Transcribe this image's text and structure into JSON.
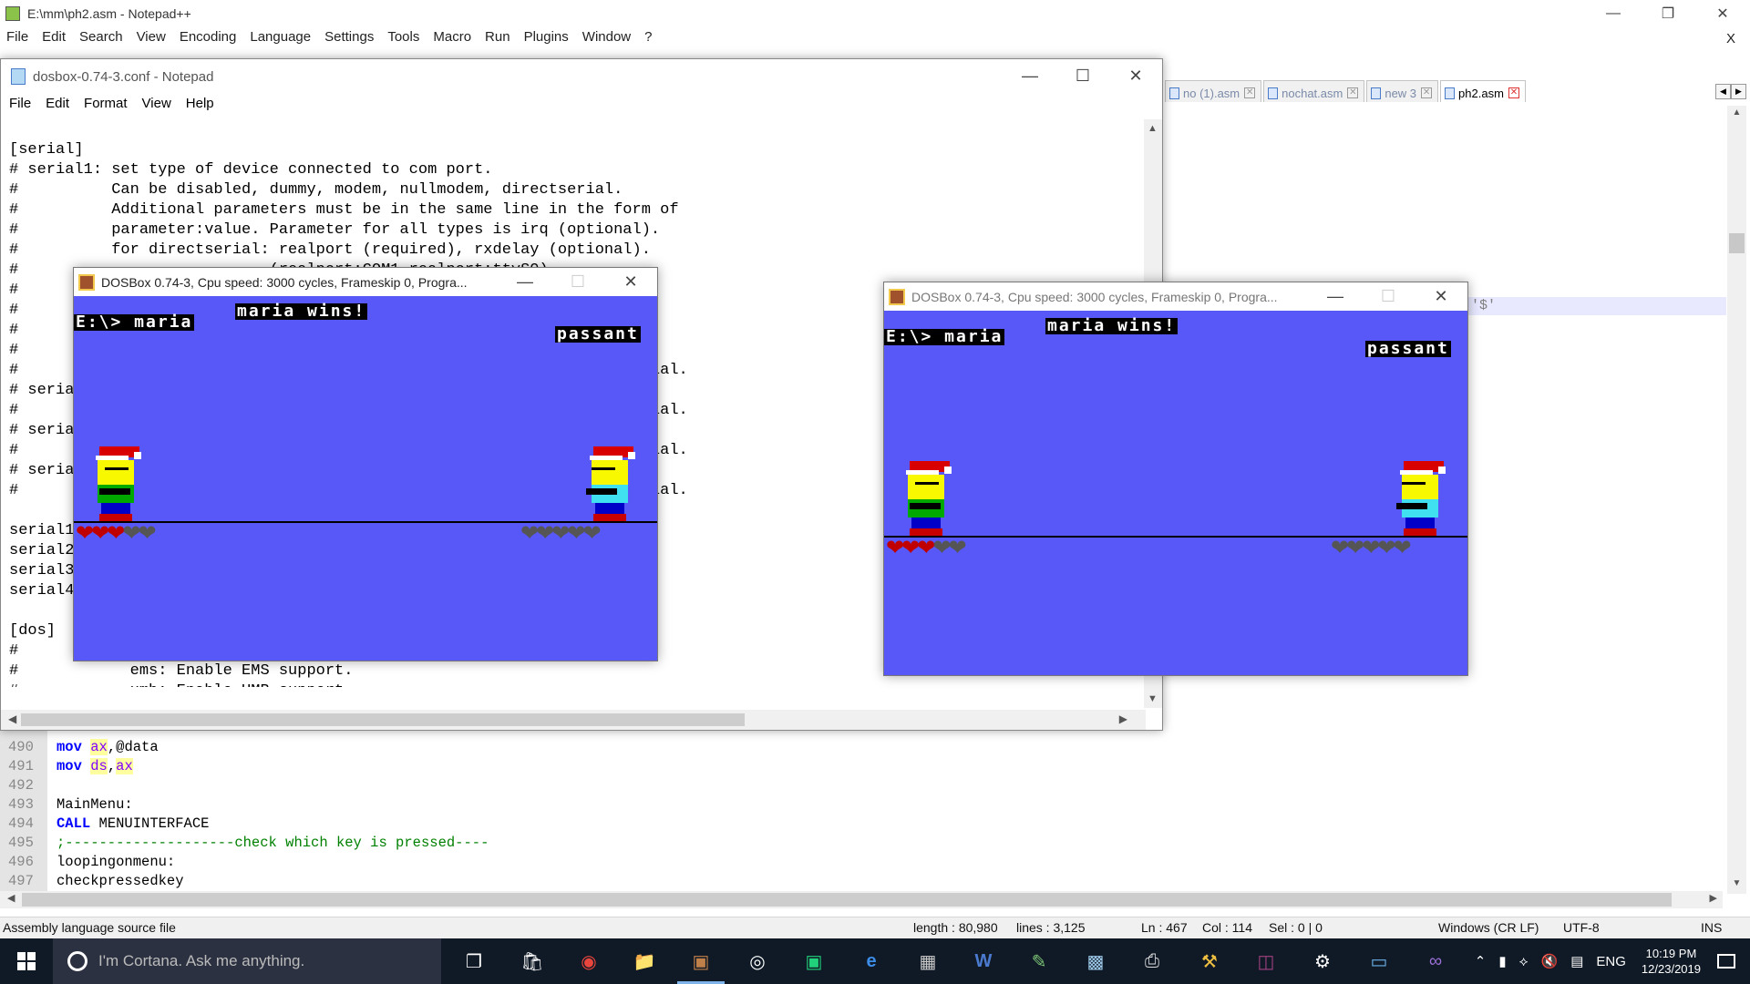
{
  "npp": {
    "title": "E:\\mm\\ph2.asm - Notepad++",
    "menu": [
      "File",
      "Edit",
      "Search",
      "View",
      "Encoding",
      "Language",
      "Settings",
      "Tools",
      "Macro",
      "Run",
      "Plugins",
      "Window",
      "?"
    ],
    "menu_close": "X",
    "tabs": [
      {
        "label": "no (1).asm",
        "active": false
      },
      {
        "label": "nochat.asm",
        "active": false
      },
      {
        "label": "new 3",
        "active": false
      },
      {
        "label": "ph2.asm",
        "active": true
      }
    ],
    "highlight_text": "'$'",
    "code_lines": [
      {
        "num": "490",
        "parts": [
          [
            "kw",
            "mov "
          ],
          [
            "reg",
            "ax"
          ],
          [
            "",
            ","
          ],
          [
            "",
            "@data"
          ]
        ]
      },
      {
        "num": "491",
        "parts": [
          [
            "kw",
            "mov "
          ],
          [
            "reg",
            "ds"
          ],
          [
            "",
            ","
          ],
          [
            "reg",
            "ax"
          ]
        ]
      },
      {
        "num": "492",
        "parts": []
      },
      {
        "num": "493",
        "parts": [
          [
            "",
            "MainMenu:"
          ]
        ]
      },
      {
        "num": "494",
        "parts": [
          [
            "kw",
            "CALL "
          ],
          [
            "",
            "MENUINTERFACE"
          ]
        ]
      },
      {
        "num": "495",
        "parts": [
          [
            "cm",
            ";--------------------check which key is pressed----"
          ]
        ]
      },
      {
        "num": "496",
        "parts": [
          [
            "",
            "loopingonmenu:"
          ]
        ]
      },
      {
        "num": "497",
        "parts": [
          [
            "",
            "checkpressedkey"
          ]
        ]
      }
    ],
    "status": {
      "filetype": "Assembly language source file",
      "length": "length : 80,980",
      "lines": "lines : 3,125",
      "ln": "Ln : 467",
      "col": "Col : 114",
      "sel": "Sel : 0 | 0",
      "eol": "Windows (CR LF)",
      "encoding": "UTF-8",
      "mode": "INS"
    }
  },
  "notepad": {
    "title": "dosbox-0.74-3.conf - Notepad",
    "menu": [
      "File",
      "Edit",
      "Format",
      "View",
      "Help"
    ],
    "text_lines": [
      "[serial]",
      "# serial1: set type of device connected to com port.",
      "#          Can be disabled, dummy, modem, nullmodem, directserial.",
      "#          Additional parameters must be in the same line in the form of",
      "#          parameter:value. Parameter for all types is irq (optional).",
      "#          for directserial: realport (required), rxdelay (optional).",
      "#                           (realport:COM1 realport:ttyS0).",
      "#",
      "#",
      "#",
      "#",
      "#                                                                   rial.",
      "# seria",
      "#                                                                   rial.",
      "# seria",
      "#                                                                   rial.",
      "# seria",
      "#                                                                   rial.",
      "",
      "serial1",
      "serial2",
      "serial3",
      "serial4",
      "",
      "[dos]",
      "#",
      "#            ems: Enable EMS support.",
      "#            umb: Enable UMB support."
    ]
  },
  "dosbox_left": {
    "title": "DOSBox 0.74-3, Cpu speed:     3000 cycles, Frameskip  0, Progra...",
    "prompt": "E:\\> maria",
    "winner": "maria wins!",
    "opponent": "passant",
    "left_hearts_red": 3,
    "left_hearts_gray": 2,
    "right_hearts_gray": 5
  },
  "dosbox_right": {
    "title": "DOSBox 0.74-3, Cpu speed:     3000 cycles, Frameskip  0, Progra...",
    "prompt": "E:\\> maria",
    "winner": "maria wins!",
    "opponent": "passant",
    "left_hearts_red": 3,
    "left_hearts_gray": 2,
    "right_hearts_gray": 5
  },
  "taskbar": {
    "search_placeholder": "I'm Cortana. Ask me anything.",
    "icons": [
      "task-view-icon",
      "store-icon",
      "chrome-icon",
      "file-explorer-icon",
      "dosbox-icon",
      "media-icon",
      "screenshot-icon",
      "edge-icon",
      "calculator-icon",
      "word-icon",
      "paint-icon",
      "notes-icon",
      "printer-icon",
      "tools-icon",
      "archive-icon",
      "settings-icon",
      "remote-icon",
      "visual-studio-icon"
    ],
    "language": "ENG",
    "time": "10:19 PM",
    "date": "12/23/2019"
  },
  "colors": {
    "dos_background": "#5858f8",
    "heart_red": "#c00000",
    "heart_gray": "#555555",
    "taskbar": "#101a26"
  }
}
